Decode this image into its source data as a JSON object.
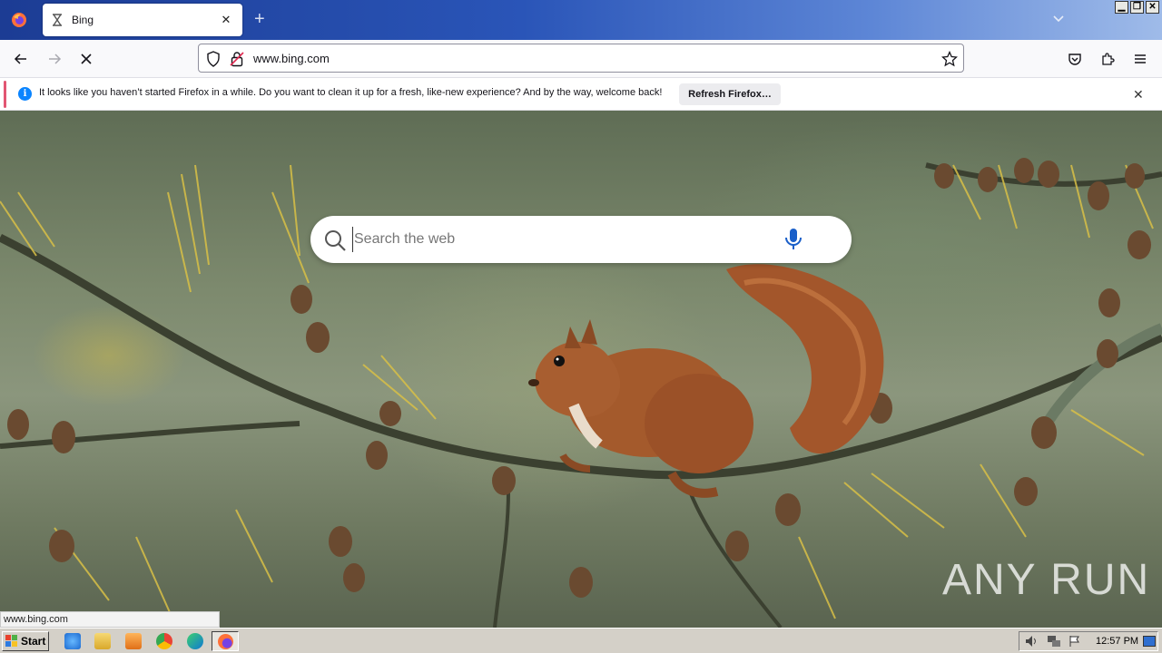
{
  "browser": {
    "tab": {
      "title": "Bing"
    },
    "url": "www.bing.com",
    "notification": {
      "message": "It looks like you haven’t started Firefox in a while. Do you want to clean it up for a fresh, like-new experience? And by the way, welcome back!",
      "button_label": "Refresh Firefox…"
    }
  },
  "page": {
    "search": {
      "placeholder": "Search the web"
    },
    "watermark": "ANY RUN",
    "status_url": "www.bing.com"
  },
  "taskbar": {
    "start_label": "Start",
    "clock": "12:57 PM"
  },
  "colors": {
    "accent": "#0a84ff",
    "notif_accent": "#e25572",
    "mic": "#1a5fc9"
  }
}
